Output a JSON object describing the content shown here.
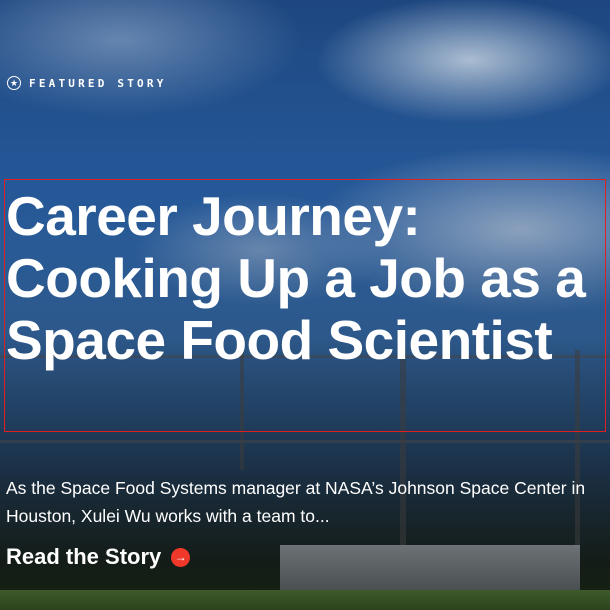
{
  "featured": {
    "eyebrow_icon": "star-circle-icon",
    "eyebrow_label": "FEATURED STORY",
    "title": "Career Journey: Cooking Up a Job as a Space Food Scientist",
    "summary": "As the Space Food Systems manager at NASA’s Johnson Space Center in Houston, Xulei Wu works with a team to...",
    "cta_label": "Read the Story",
    "cta_icon": "arrow-right-circle-icon",
    "accent_color": "#f0382b",
    "highlight_border_color": "#e02020"
  }
}
